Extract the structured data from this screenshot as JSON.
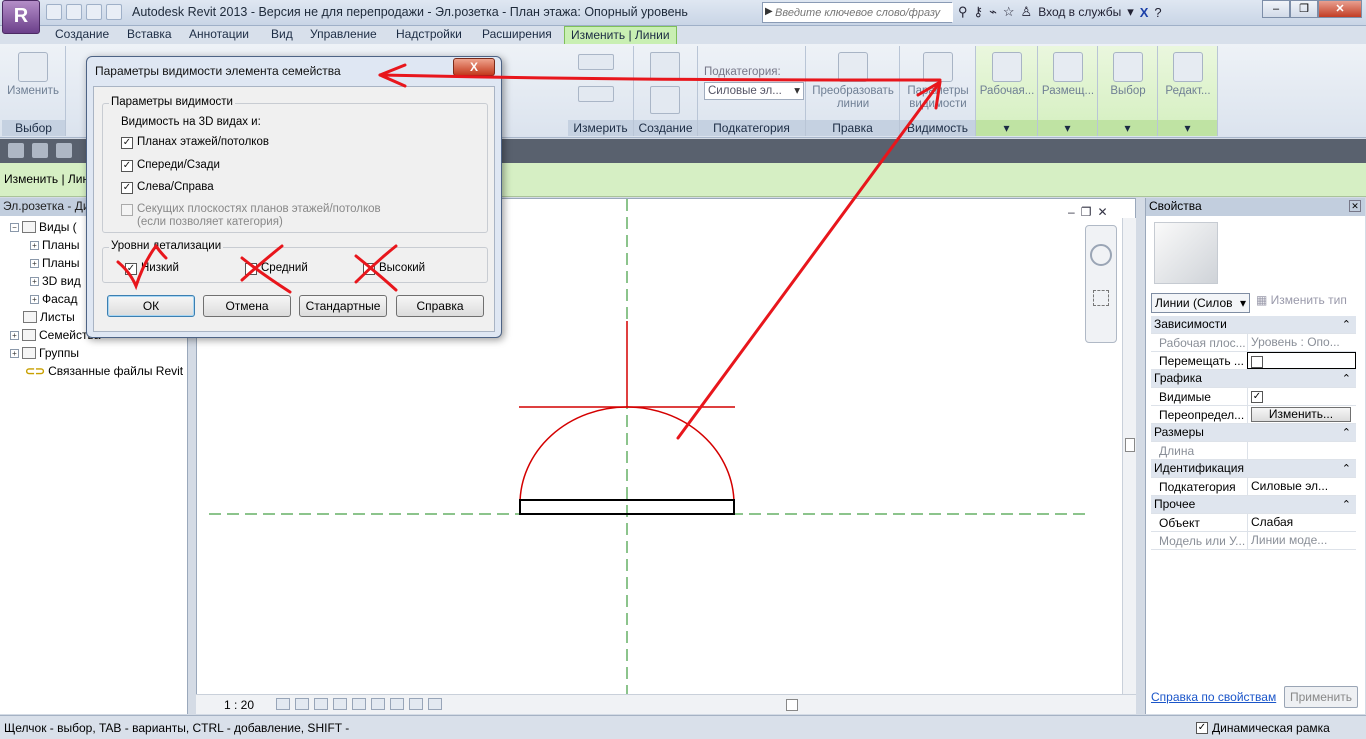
{
  "app": {
    "title": "Autodesk Revit 2013 -  Версия не для перепродажи -    Эл.розетка - План этажа: Опорный уровень",
    "search_placeholder": "Введите ключевое слово/фразу",
    "signin": "Вход в службы"
  },
  "tabs": [
    "Создание",
    "Вставка",
    "Аннотации",
    "Вид",
    "Управление",
    "Надстройки",
    "Расширения"
  ],
  "active_tab": "Изменить | Линии",
  "ribbon": {
    "select_label": "Выбор",
    "modify_label": "Изменить",
    "measure_label": "Измерить",
    "create_label": "Создание",
    "subcategory_panel": "Подкатегория",
    "subcategory_caption": "Подкатегория:",
    "subcategory_value": "Силовые эл...",
    "edit_panel": "Правка",
    "convert_label": "Преобразовать линии",
    "visibility_panel": "Видимость",
    "visibility_params_label": "Параметры видимости",
    "workplane_label": "Рабочая...",
    "places_label": "Размещ...",
    "filter_label": "Выбор",
    "edit_label": "Редакт..."
  },
  "options_bar": {
    "label": "Изменить | Лин"
  },
  "browser": {
    "title": "Эл.розетка - Ди",
    "items": [
      {
        "label": "Виды (",
        "level": 0
      },
      {
        "label": "Планы",
        "level": 1
      },
      {
        "label": "Планы",
        "level": 1
      },
      {
        "label": "3D вид",
        "level": 1
      },
      {
        "label": "Фасад",
        "level": 1
      },
      {
        "label": "Листы",
        "level": 0
      },
      {
        "label": "Семейства",
        "level": 0
      },
      {
        "label": "Группы",
        "level": 0
      },
      {
        "label": "Связанные файлы Revit",
        "level": 0
      }
    ]
  },
  "view": {
    "scale": "1 : 20"
  },
  "properties": {
    "title": "Свойства",
    "type_selector": "Линии (Силов",
    "edit_type": "Изменить тип",
    "groups": [
      {
        "name": "Зависимости",
        "rows": [
          {
            "key": "Рабочая плос...",
            "value": "Уровень : Опо...",
            "dim": true
          },
          {
            "key": "Перемещать ...",
            "value": "",
            "checkbox": false
          }
        ]
      },
      {
        "name": "Графика",
        "rows": [
          {
            "key": "Видимые",
            "value": "",
            "checkbox": true
          },
          {
            "key": "Переопредел...",
            "value": "Изменить...",
            "button": true
          }
        ]
      },
      {
        "name": "Размеры",
        "rows": [
          {
            "key": "Длина",
            "value": "",
            "dim": true
          }
        ]
      },
      {
        "name": "Идентификация",
        "rows": [
          {
            "key": "Подкатегория",
            "value": "Силовые эл..."
          }
        ]
      },
      {
        "name": "Прочее",
        "rows": [
          {
            "key": "Объект",
            "value": "Слабая"
          },
          {
            "key": "Модель или У...",
            "value": "Линии моде...",
            "dim": true
          }
        ]
      }
    ],
    "help_link": "Справка по свойствам",
    "apply": "Применить"
  },
  "status": {
    "text": "Щелчок - выбор, TAB - варианты, CTRL - добавление, SHIFT - ",
    "dynamic_frame": "Динамическая рамка"
  },
  "dialog": {
    "title": "Параметры видимости элемента семейства",
    "close": "X",
    "visibility_group": "Параметры видимости",
    "visibility_3d": "Видимость на 3D видах и:",
    "options": [
      {
        "label": "Планах этажей/потолков",
        "checked": true
      },
      {
        "label": "Спереди/Сзади",
        "checked": true
      },
      {
        "label": "Слева/Справа",
        "checked": true
      }
    ],
    "section_option": "Секущих плоскостях планов этажей/потолков",
    "section_option_note": "(если позволяет категория)",
    "detail_group": "Уровни детализации",
    "detail_levels": [
      {
        "label": "Низкий",
        "checked": true
      },
      {
        "label": "Средний",
        "checked": false
      },
      {
        "label": "Высокий",
        "checked": false
      }
    ],
    "buttons": {
      "ok": "ОК",
      "cancel": "Отмена",
      "defaults": "Стандартные",
      "help": "Справка"
    }
  },
  "colors": {
    "annotation_red": "#e8161c",
    "active_tab": "#c9efb3",
    "ref_plane": "#1a8a1a",
    "line_red": "#d40000"
  }
}
